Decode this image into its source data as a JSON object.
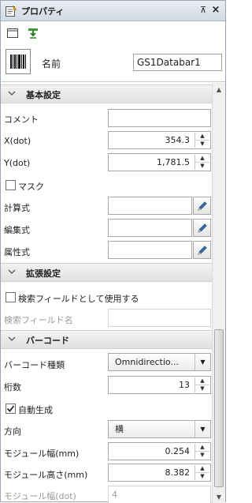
{
  "window": {
    "title": "プロパティ",
    "pin_glyph": "⊼",
    "close_glyph": "×"
  },
  "toolbar": {
    "icons": [
      "window-icon",
      "green-pin-icon"
    ]
  },
  "name_row": {
    "label": "名前",
    "value": "GS1Databar1"
  },
  "sections": {
    "basic": {
      "label": "基本設定",
      "comment_label": "コメント",
      "comment_value": "",
      "x_label": "X(dot)",
      "x_value": "354.3",
      "y_label": "Y(dot)",
      "y_value": "1,781.5",
      "mask_label": "マスク",
      "mask_checked": false,
      "calc_label": "計算式",
      "calc_value": "",
      "edit_label": "編集式",
      "edit_value": "",
      "attr_label": "属性式",
      "attr_value": ""
    },
    "extended": {
      "label": "拡張設定",
      "use_search_label": "検索フィールドとして使用する",
      "use_search_checked": false,
      "search_name_label": "検索フィールド名",
      "search_name_value": ""
    },
    "barcode": {
      "label": "バーコード",
      "type_label": "バーコード種類",
      "type_value": "Omnidirectio...",
      "digits_label": "桁数",
      "digits_value": "13",
      "auto_label": "自動生成",
      "auto_checked": true,
      "dir_label": "方向",
      "dir_value": "横",
      "module_width_label": "モジュール幅(mm)",
      "module_width_value": "0.254",
      "module_height_label": "モジュール高さ(mm)",
      "module_height_value": "8.382",
      "module_width_dot_label": "モジュール幅(dot)",
      "module_width_dot_value": "4"
    }
  },
  "glyphs": {
    "spin_up": "▲",
    "spin_down": "▼",
    "combo_arrow": "▼",
    "check": "✔"
  }
}
